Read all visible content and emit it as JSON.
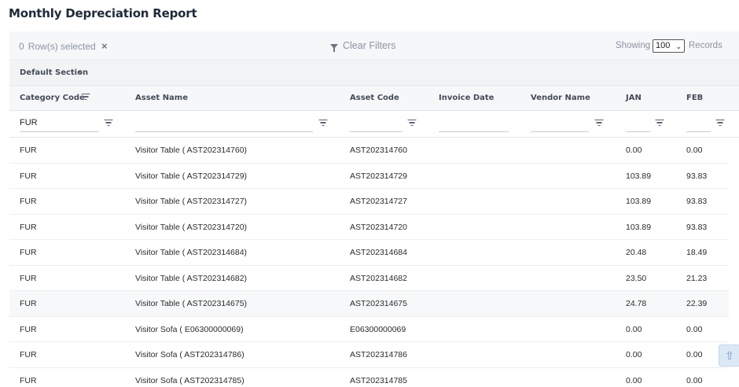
{
  "page": {
    "title": "Monthly Depreciation Report"
  },
  "toolbar": {
    "selected_count": "0",
    "selected_label": "Row(s) selected",
    "clear_icon": "×",
    "clear_filters_label": "Clear Filters",
    "showing_label": "Showing",
    "records_value": "100",
    "records_label": "Records"
  },
  "section": {
    "label": "Default Section",
    "toggle_icon": "chevron-left-icon"
  },
  "grid": {
    "columns": [
      {
        "key": "category",
        "label": "Category Code"
      },
      {
        "key": "asset_name",
        "label": "Asset Name"
      },
      {
        "key": "asset_code",
        "label": "Asset Code"
      },
      {
        "key": "invoice_date",
        "label": "Invoice Date"
      },
      {
        "key": "vendor_name",
        "label": "Vendor Name"
      },
      {
        "key": "jan",
        "label": "JAN"
      },
      {
        "key": "feb",
        "label": "FEB"
      }
    ],
    "filters": {
      "category": "FUR",
      "asset_name": "",
      "asset_code": "",
      "invoice_date": "",
      "vendor_name": "",
      "jan": "",
      "feb": ""
    },
    "rows": [
      {
        "category": "FUR",
        "asset_name": "Visitor Table ( AST202314760)",
        "asset_code": "AST202314760",
        "invoice_date": "",
        "vendor_name": "",
        "jan": "0.00",
        "feb": "0.00"
      },
      {
        "category": "FUR",
        "asset_name": "Visitor Table ( AST202314729)",
        "asset_code": "AST202314729",
        "invoice_date": "",
        "vendor_name": "",
        "jan": "103.89",
        "feb": "93.83"
      },
      {
        "category": "FUR",
        "asset_name": "Visitor Table ( AST202314727)",
        "asset_code": "AST202314727",
        "invoice_date": "",
        "vendor_name": "",
        "jan": "103.89",
        "feb": "93.83"
      },
      {
        "category": "FUR",
        "asset_name": "Visitor Table ( AST202314720)",
        "asset_code": "AST202314720",
        "invoice_date": "",
        "vendor_name": "",
        "jan": "103.89",
        "feb": "93.83"
      },
      {
        "category": "FUR",
        "asset_name": "Visitor Table ( AST202314684)",
        "asset_code": "AST202314684",
        "invoice_date": "",
        "vendor_name": "",
        "jan": "20.48",
        "feb": "18.49"
      },
      {
        "category": "FUR",
        "asset_name": "Visitor Table ( AST202314682)",
        "asset_code": "AST202314682",
        "invoice_date": "",
        "vendor_name": "",
        "jan": "23.50",
        "feb": "21.23"
      },
      {
        "category": "FUR",
        "asset_name": "Visitor Table ( AST202314675)",
        "asset_code": "AST202314675",
        "invoice_date": "",
        "vendor_name": "",
        "jan": "24.78",
        "feb": "22.39"
      },
      {
        "category": "FUR",
        "asset_name": "Visitor Sofa ( E06300000069)",
        "asset_code": "E06300000069",
        "invoice_date": "",
        "vendor_name": "",
        "jan": "0.00",
        "feb": "0.00"
      },
      {
        "category": "FUR",
        "asset_name": "Visitor Sofa ( AST202314786)",
        "asset_code": "AST202314786",
        "invoice_date": "",
        "vendor_name": "",
        "jan": "0.00",
        "feb": "0.00"
      },
      {
        "category": "FUR",
        "asset_name": "Visitor Sofa ( AST202314785)",
        "asset_code": "AST202314785",
        "invoice_date": "",
        "vendor_name": "",
        "jan": "0.00",
        "feb": "0.00"
      }
    ],
    "highlighted_row": 6
  },
  "scroll_top": {
    "icon": "arrow-up-icon"
  }
}
